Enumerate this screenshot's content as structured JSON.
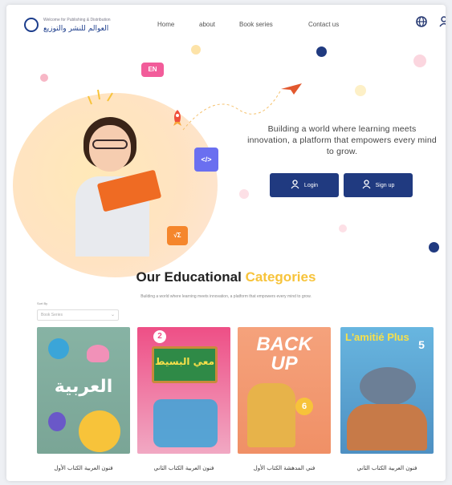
{
  "header": {
    "logo_en": "Welcome for Publishing & Distribution",
    "logo_ar": "العوالم للنشر والتوزيع",
    "nav": [
      "Home",
      "about",
      "Book series",
      "Contact us"
    ],
    "globe_icon": "globe-icon",
    "user_icon": "user-icon"
  },
  "hero": {
    "text": "Building a world where learning meets innovation, a platform that empowers every mind to grow.",
    "login_label": "Login",
    "signup_label": "Sign up",
    "tags": {
      "en": "EN",
      "code": "</>",
      "sum": "√Σ"
    }
  },
  "categories": {
    "title_main": "Our Educational",
    "title_highlight": "Categories",
    "subtitle": "Building a world where learning meets innovation, a platform that empowers every mind to grow.",
    "filter_label": "Sort By",
    "filter_value": "Book Series",
    "cards": [
      {
        "title": "فنون العربية الكتاب الأول",
        "cover": "العربية"
      },
      {
        "title": "فنون العربية الكتاب الثاني",
        "cover": "معي البسيط",
        "number": "2"
      },
      {
        "title": "فني المدهشة الكتاب الأول",
        "cover": "BACK UP",
        "number": "6"
      },
      {
        "title": "فنون العربية الكتاب الثاني",
        "cover": "L'amitié Plus",
        "number": "5"
      }
    ]
  },
  "colors": {
    "primary": "#203a80",
    "accent": "#f7c33a",
    "tag_pink": "#f25c9a",
    "tag_purple": "#6a6ff0",
    "tag_orange": "#f5862c"
  }
}
